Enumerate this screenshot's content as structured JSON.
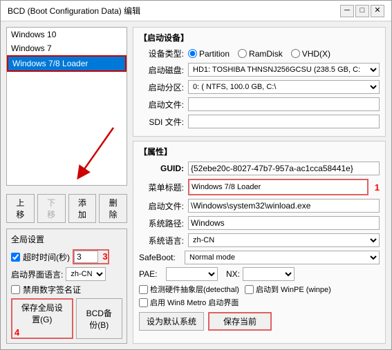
{
  "window": {
    "title": "BCD (Boot Configuration Data) 编辑",
    "close_btn": "✕",
    "minimize_btn": "─",
    "maximize_btn": "□"
  },
  "left_panel": {
    "list_items": [
      {
        "label": "Windows 10",
        "selected": false
      },
      {
        "label": "Windows 7",
        "selected": false
      },
      {
        "label": "Windows 7/8 Loader",
        "selected": true
      }
    ],
    "buttons": {
      "up": "上移",
      "down": "下移",
      "add": "添加",
      "delete": "删除"
    },
    "global_settings_title": "全局设置",
    "timeout_label": "超时时间(秒)",
    "timeout_value": "3",
    "lang_label": "启动界面语言:",
    "lang_value": "zh-CN",
    "disable_sign_label": "禁用数字签名证",
    "save_global_label": "保存全局设置(G)",
    "bcd_backup_label": "BCD备份(B)"
  },
  "right_panel": {
    "startup_device_title": "【启动设备】",
    "device_type_label": "设备类型:",
    "device_options": [
      "Partition",
      "RamDisk",
      "VHD(X)"
    ],
    "device_selected": "Partition",
    "startup_disk_label": "启动磁盘:",
    "startup_disk_value": "HD1: TOSHIBA THNSNJ256GCSU (238.5 GB, C: ∨",
    "startup_partition_label": "启动分区:",
    "startup_partition_value": "0: ( NTFS, 100.0 GB, C:\\",
    "startup_file_label": "启动文件:",
    "startup_file_value": "",
    "sdi_file_label": "SDI 文件:",
    "sdi_file_value": "",
    "attr_title": "【属性】",
    "guid_label": "GUID:",
    "guid_value": "{52ebe20c-8027-47b7-957a-ac1cca58441e}",
    "menu_title_label": "菜单标题:",
    "menu_title_value": "Windows 7/8 Loader",
    "menu_title_annotation": "1",
    "startup_file2_label": "启动文件:",
    "startup_file2_value": "\\Windows\\system32\\winload.exe",
    "sys_path_label": "系统路径:",
    "sys_path_value": "Windows",
    "sys_lang_label": "系统语言:",
    "sys_lang_value": "zh-CN",
    "safeboot_label": "SafeBoot:",
    "safeboot_value": "Normal mode",
    "pae_label": "PAE:",
    "pae_value": "",
    "nx_label": "NX:",
    "nx_value": "",
    "detect_hal_label": "检测硬件抽象层(detecthal)",
    "winpe_label": "启动到 WinPE (winpe)",
    "win8_metro_label": "启用 Win8 Metro 启动界面",
    "set_default_label": "设为默认系统",
    "save_current_label": "保存当前",
    "annotation3_label": "3",
    "annotation4_label": "4"
  }
}
